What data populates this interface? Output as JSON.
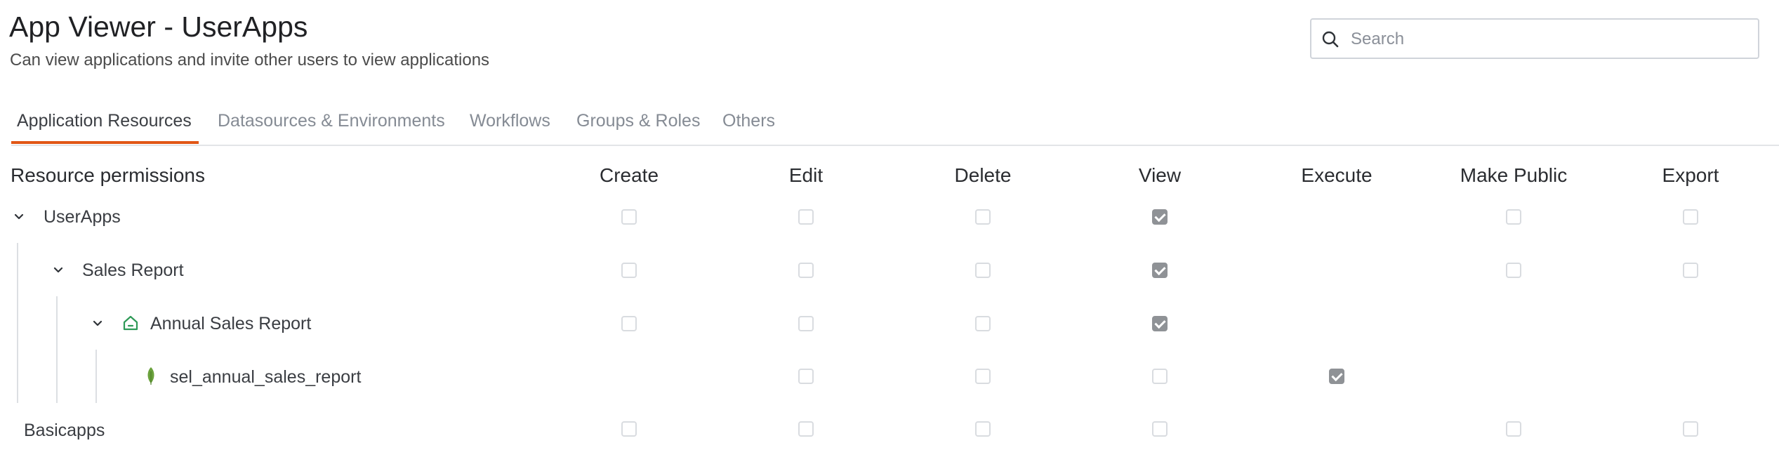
{
  "header": {
    "title": "App Viewer - UserApps",
    "subtitle": "Can view applications and invite other users to view applications"
  },
  "search": {
    "placeholder": "Search",
    "value": ""
  },
  "tabs": [
    {
      "label": "Application Resources",
      "active": true
    },
    {
      "label": "Datasources & Environments",
      "active": false
    },
    {
      "label": "Workflows",
      "active": false
    },
    {
      "label": "Groups & Roles",
      "active": false
    },
    {
      "label": "Others",
      "active": false
    }
  ],
  "table": {
    "first_column": "Resource permissions",
    "columns": [
      "Create",
      "Edit",
      "Delete",
      "View",
      "Execute",
      "Make Public",
      "Export"
    ],
    "rows": [
      {
        "label": "UserApps",
        "level": 0,
        "expander": true,
        "icon": "",
        "perms": {
          "Create": false,
          "Edit": false,
          "Delete": false,
          "View": true,
          "Make Public": false,
          "Export": false
        }
      },
      {
        "label": "Sales Report",
        "level": 1,
        "expander": true,
        "icon": "",
        "perms": {
          "Create": false,
          "Edit": false,
          "Delete": false,
          "View": true,
          "Make Public": false,
          "Export": false
        }
      },
      {
        "label": "Annual Sales Report",
        "level": 2,
        "expander": true,
        "icon": "home-icon",
        "perms": {
          "Create": false,
          "Edit": false,
          "Delete": false,
          "View": true
        }
      },
      {
        "label": "sel_annual_sales_report",
        "level": 3,
        "expander": false,
        "icon": "leaf-icon",
        "perms": {
          "Edit": false,
          "Delete": false,
          "View": false,
          "Execute": true
        }
      },
      {
        "label": "Basicapps",
        "level": 0,
        "expander": false,
        "icon": "",
        "perms": {
          "Create": false,
          "Edit": false,
          "Delete": false,
          "View": false,
          "Make Public": false,
          "Export": false
        }
      }
    ]
  },
  "colors": {
    "accent": "#e15615",
    "checked": "#8f9296",
    "home_icon": "#2e9a57",
    "leaf_icon": "#6aa13c"
  }
}
